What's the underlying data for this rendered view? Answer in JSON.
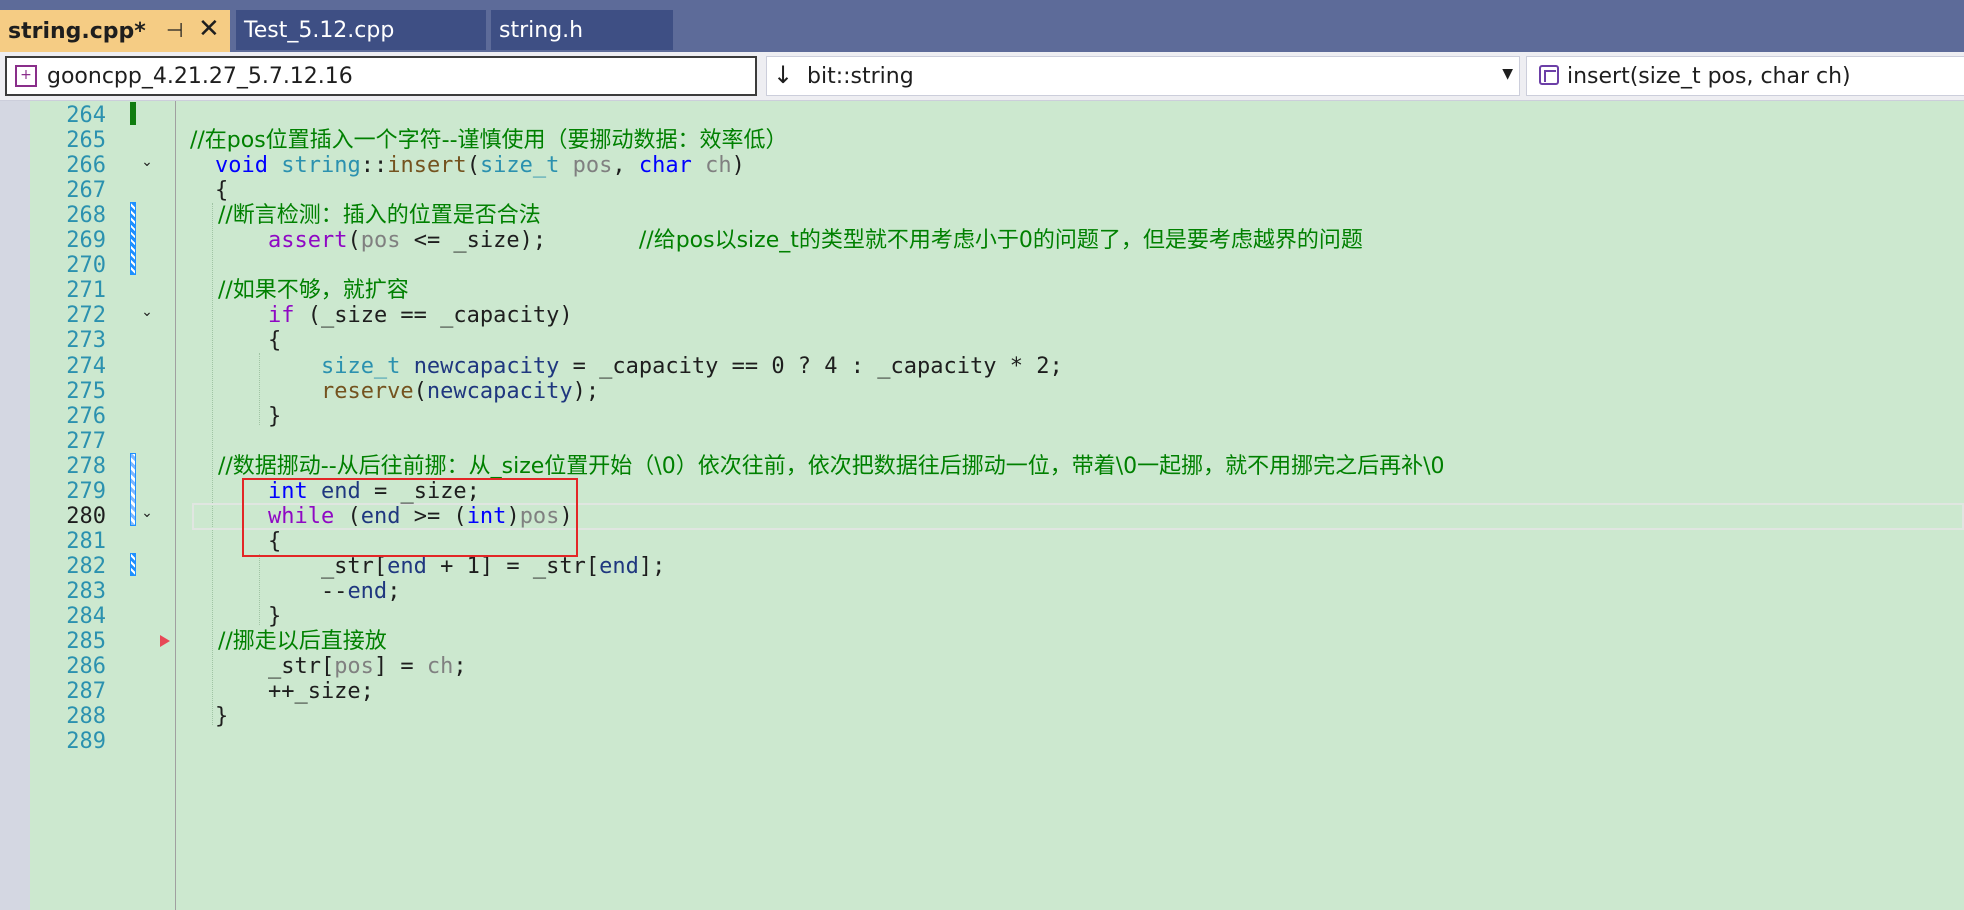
{
  "tabs": [
    {
      "label": "string.cpp*",
      "active": true
    },
    {
      "label": "Test_5.12.cpp",
      "active": false
    },
    {
      "label": "string.h",
      "active": false
    }
  ],
  "tab_pin_glyph": "⊣",
  "tab_close_glyph": "✕",
  "nav": {
    "project": "gooncpp_4.21.27_5.7.12.16",
    "scope": "bit::string",
    "member": "insert(size_t pos, char ch)"
  },
  "icons": {
    "project": "cpp-project-icon",
    "scope": "arrow-down-icon",
    "member": "method-cube-icon"
  },
  "current_line": 280,
  "lines": [
    {
      "n": 264,
      "segments": []
    },
    {
      "n": 265,
      "segments": [
        {
          "t": "    //在pos位置插入一个字符--谨慎使用（要挪动数据：效率低）",
          "c": "cmt"
        }
      ]
    },
    {
      "n": 266,
      "segments": [
        {
          "t": "    ",
          "c": ""
        },
        {
          "t": "void",
          "c": "kw"
        },
        {
          "t": " ",
          "c": ""
        },
        {
          "t": "string",
          "c": "ty"
        },
        {
          "t": "::",
          "c": ""
        },
        {
          "t": "insert",
          "c": "fn"
        },
        {
          "t": "(",
          "c": ""
        },
        {
          "t": "size_t",
          "c": "ty"
        },
        {
          "t": " ",
          "c": ""
        },
        {
          "t": "pos",
          "c": "pa"
        },
        {
          "t": ", ",
          "c": ""
        },
        {
          "t": "char",
          "c": "kw"
        },
        {
          "t": " ",
          "c": ""
        },
        {
          "t": "ch",
          "c": "pa"
        },
        {
          "t": ")",
          "c": ""
        }
      ]
    },
    {
      "n": 267,
      "segments": [
        {
          "t": "    {",
          "c": ""
        }
      ]
    },
    {
      "n": 268,
      "segments": [
        {
          "t": "        //断言检测：插入的位置是否合法",
          "c": "cmt"
        }
      ]
    },
    {
      "n": 269,
      "segments": [
        {
          "t": "        ",
          "c": ""
        },
        {
          "t": "assert",
          "c": "fl"
        },
        {
          "t": "(",
          "c": ""
        },
        {
          "t": "pos",
          "c": "pa"
        },
        {
          "t": " <= _size);       ",
          "c": ""
        },
        {
          "t": "//给pos以size_t的类型就不用考虑小于0的问题了，但是要考虑越界的问题",
          "c": "cmt"
        }
      ]
    },
    {
      "n": 270,
      "segments": []
    },
    {
      "n": 271,
      "segments": [
        {
          "t": "        //如果不够，就扩容",
          "c": "cmt"
        }
      ]
    },
    {
      "n": 272,
      "segments": [
        {
          "t": "        ",
          "c": ""
        },
        {
          "t": "if",
          "c": "fl"
        },
        {
          "t": " (_size == _capacity)",
          "c": ""
        }
      ]
    },
    {
      "n": 273,
      "segments": [
        {
          "t": "        {",
          "c": ""
        }
      ]
    },
    {
      "n": 274,
      "segments": [
        {
          "t": "            ",
          "c": ""
        },
        {
          "t": "size_t",
          "c": "ty"
        },
        {
          "t": " ",
          "c": ""
        },
        {
          "t": "newcapacity",
          "c": "lc"
        },
        {
          "t": " = _capacity == 0 ? 4 : _capacity * 2;",
          "c": ""
        }
      ]
    },
    {
      "n": 275,
      "segments": [
        {
          "t": "            ",
          "c": ""
        },
        {
          "t": "reserve",
          "c": "fn"
        },
        {
          "t": "(",
          "c": ""
        },
        {
          "t": "newcapacity",
          "c": "lc"
        },
        {
          "t": ");",
          "c": ""
        }
      ]
    },
    {
      "n": 276,
      "segments": [
        {
          "t": "        }",
          "c": ""
        }
      ]
    },
    {
      "n": 277,
      "segments": []
    },
    {
      "n": 278,
      "segments": [
        {
          "t": "        //数据挪动--从后往前挪：从_size位置开始（\\0）依次往前，依次把数据往后挪动一位，带着\\0一起挪，就不用挪完之后再补\\0",
          "c": "cmt"
        }
      ]
    },
    {
      "n": 279,
      "segments": [
        {
          "t": "        ",
          "c": ""
        },
        {
          "t": "int",
          "c": "kw"
        },
        {
          "t": " ",
          "c": ""
        },
        {
          "t": "end",
          "c": "lc"
        },
        {
          "t": " = _size;",
          "c": ""
        }
      ]
    },
    {
      "n": 280,
      "segments": [
        {
          "t": "        ",
          "c": ""
        },
        {
          "t": "while",
          "c": "fl"
        },
        {
          "t": " (",
          "c": ""
        },
        {
          "t": "end",
          "c": "lc"
        },
        {
          "t": " >= (",
          "c": ""
        },
        {
          "t": "int",
          "c": "kw"
        },
        {
          "t": ")",
          "c": ""
        },
        {
          "t": "pos",
          "c": "pa"
        },
        {
          "t": ")",
          "c": ""
        }
      ]
    },
    {
      "n": 281,
      "segments": [
        {
          "t": "        {",
          "c": ""
        }
      ]
    },
    {
      "n": 282,
      "segments": [
        {
          "t": "            _str[",
          "c": ""
        },
        {
          "t": "end",
          "c": "lc"
        },
        {
          "t": " + 1] = _str[",
          "c": ""
        },
        {
          "t": "end",
          "c": "lc"
        },
        {
          "t": "];",
          "c": ""
        }
      ]
    },
    {
      "n": 283,
      "segments": [
        {
          "t": "            --",
          "c": ""
        },
        {
          "t": "end",
          "c": "lc"
        },
        {
          "t": ";",
          "c": ""
        }
      ]
    },
    {
      "n": 284,
      "segments": [
        {
          "t": "        }",
          "c": ""
        }
      ]
    },
    {
      "n": 285,
      "segments": [
        {
          "t": "        //挪走以后直接放",
          "c": "cmt"
        }
      ]
    },
    {
      "n": 286,
      "segments": [
        {
          "t": "        _str[",
          "c": ""
        },
        {
          "t": "pos",
          "c": "pa"
        },
        {
          "t": "] = ",
          "c": ""
        },
        {
          "t": "ch",
          "c": "pa"
        },
        {
          "t": ";",
          "c": ""
        }
      ]
    },
    {
      "n": 287,
      "segments": [
        {
          "t": "        ++_size;",
          "c": ""
        }
      ]
    },
    {
      "n": 288,
      "segments": [
        {
          "t": "    }",
          "c": ""
        }
      ]
    },
    {
      "n": 289,
      "segments": []
    }
  ],
  "fold_lines": [
    266,
    272,
    280
  ],
  "fold_glyph": "⌄",
  "change_markers": [
    {
      "from": 264,
      "to": 264,
      "kind": "green"
    },
    {
      "from": 268,
      "to": 270,
      "kind": "blue"
    },
    {
      "from": 278,
      "to": 280,
      "kind": "blue-hollow"
    },
    {
      "from": 282,
      "to": 282,
      "kind": "blue"
    }
  ],
  "breakpoint_arrow_line": 285,
  "highlight_box": {
    "from_line": 279,
    "to_line": 281,
    "label": "red-annotation-box"
  },
  "colors": {
    "editor_bg": "#cce8cf",
    "tab_active": "#f5cc84",
    "tab_inactive": "#3e4f84",
    "keyword": "#0000ff",
    "type": "#2b91af",
    "comment": "#008000",
    "control_flow": "#8f08c4",
    "annotation": "#e32626"
  }
}
